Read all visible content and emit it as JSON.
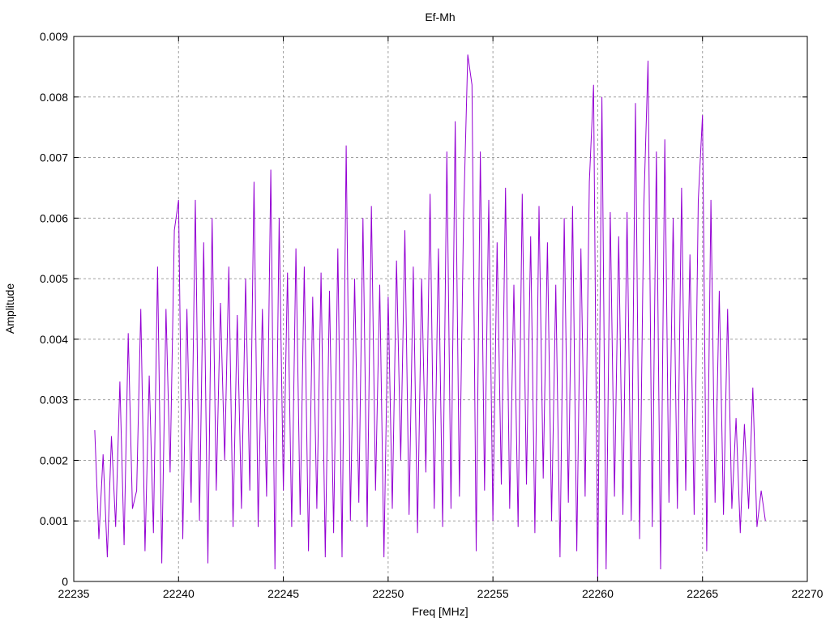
{
  "chart_data": {
    "type": "line",
    "title": "Ef-Mh",
    "xlabel": "Freq [MHz]",
    "ylabel": "Amplitude",
    "xlim": [
      22235,
      22270
    ],
    "ylim": [
      0,
      0.009
    ],
    "xticks": [
      "22235",
      "22240",
      "22245",
      "22250",
      "22255",
      "22260",
      "22265",
      "22270"
    ],
    "yticks": [
      "0",
      "0.001",
      "0.002",
      "0.003",
      "0.004",
      "0.005",
      "0.006",
      "0.007",
      "0.008",
      "0.009"
    ],
    "grid": true,
    "legend": "none",
    "series": [
      {
        "name": "Ef-Mh",
        "color": "#9400d3",
        "x_start": 22236,
        "x_step": 0.2,
        "values": [
          0.0025,
          0.0007,
          0.0021,
          0.0004,
          0.0024,
          0.0009,
          0.0033,
          0.0006,
          0.0041,
          0.0012,
          0.0015,
          0.0045,
          0.0005,
          0.0034,
          0.0008,
          0.0052,
          0.0003,
          0.0045,
          0.0018,
          0.0058,
          0.0063,
          0.0007,
          0.0045,
          0.0013,
          0.0063,
          0.001,
          0.0056,
          0.0003,
          0.006,
          0.0015,
          0.0046,
          0.002,
          0.0052,
          0.0009,
          0.0044,
          0.0012,
          0.005,
          0.0015,
          0.0066,
          0.0009,
          0.0045,
          0.0014,
          0.0068,
          0.0002,
          0.006,
          0.0015,
          0.0051,
          0.0009,
          0.0055,
          0.0011,
          0.0052,
          0.0005,
          0.0047,
          0.0012,
          0.0051,
          0.0004,
          0.0048,
          0.0008,
          0.0055,
          0.0004,
          0.0072,
          0.001,
          0.005,
          0.0013,
          0.006,
          0.0009,
          0.0062,
          0.0015,
          0.0049,
          0.0004,
          0.0047,
          0.0012,
          0.0053,
          0.002,
          0.0058,
          0.0011,
          0.0052,
          0.0008,
          0.005,
          0.0018,
          0.0064,
          0.0012,
          0.0055,
          0.0009,
          0.0071,
          0.0012,
          0.0076,
          0.0014,
          0.006,
          0.0087,
          0.0082,
          0.0005,
          0.0071,
          0.0015,
          0.0063,
          0.001,
          0.0056,
          0.0016,
          0.0065,
          0.0012,
          0.0049,
          0.0009,
          0.0064,
          0.0016,
          0.0057,
          0.0008,
          0.0062,
          0.0017,
          0.0056,
          0.001,
          0.0049,
          0.0004,
          0.006,
          0.0013,
          0.0062,
          0.0005,
          0.0055,
          0.0014,
          0.0066,
          0.0082,
          0.0,
          0.008,
          0.0002,
          0.0061,
          0.0014,
          0.0057,
          0.0011,
          0.0061,
          0.001,
          0.0079,
          0.0007,
          0.0062,
          0.0086,
          0.0009,
          0.0071,
          0.0002,
          0.0073,
          0.0013,
          0.006,
          0.0012,
          0.0065,
          0.0015,
          0.0054,
          0.0011,
          0.0063,
          0.0077,
          0.0005,
          0.0063,
          0.0013,
          0.0048,
          0.0011,
          0.0045,
          0.0012,
          0.0027,
          0.0008,
          0.0026,
          0.0012,
          0.0032,
          0.0009,
          0.0015,
          0.001
        ]
      }
    ]
  }
}
